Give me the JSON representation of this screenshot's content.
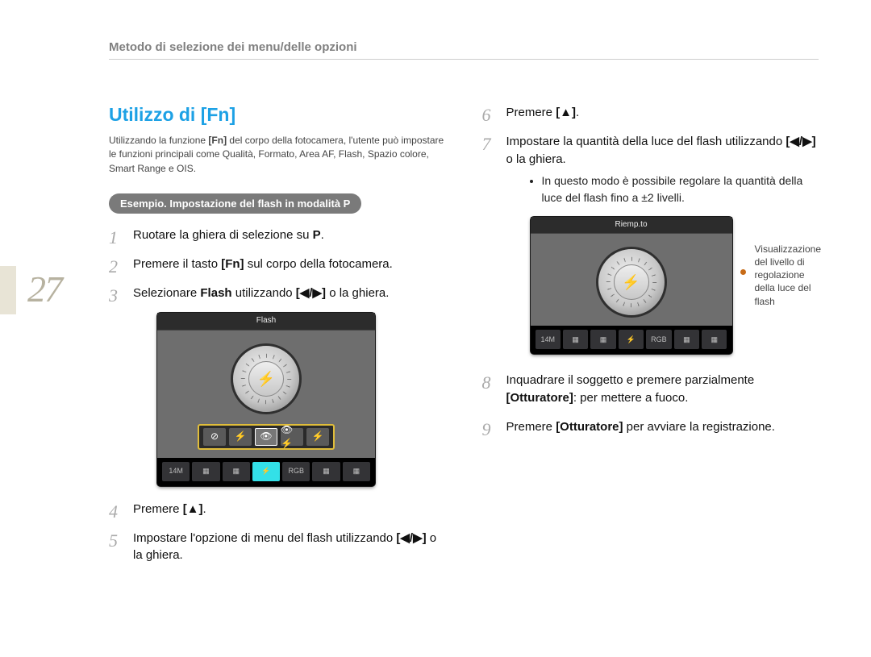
{
  "header": "Metodo di selezione dei menu/delle opzioni",
  "page_number": "27",
  "title": "Utilizzo di [Fn]",
  "intro": {
    "pre": "Utilizzando la funzione ",
    "bold": "[Fn]",
    "post": " del corpo della fotocamera, l'utente può impostare le funzioni principali come Qualità, Formato, Area AF, Flash, Spazio colore, Smart Range e OIS."
  },
  "example_pill": "Esempio. Impostazione del flash in modalità P",
  "figure1": {
    "title": "Flash",
    "dial_icon": "⚡",
    "options": [
      "⊘",
      "⚡",
      "👁",
      "👁⚡",
      "⚡"
    ],
    "thumbs": [
      "14M",
      "▦",
      "▦",
      "⚡",
      "RGB",
      "▦",
      "▦"
    ],
    "active_thumb_index": 3
  },
  "figure2": {
    "title": "Riemp.to",
    "dial_icon": "⚡",
    "annotation": "Visualizzazione del livello di regolazione della luce del flash",
    "thumbs": [
      "14M",
      "▦",
      "▦",
      "⚡",
      "RGB",
      "▦",
      "▦"
    ]
  },
  "steps_left": [
    {
      "fragments": [
        {
          "t": "Ruotare la ghiera di selezione su "
        },
        {
          "t": "P",
          "b": true
        },
        {
          "t": "."
        }
      ]
    },
    {
      "fragments": [
        {
          "t": "Premere il tasto "
        },
        {
          "t": "[Fn]",
          "b": true
        },
        {
          "t": " sul corpo della fotocamera."
        }
      ]
    },
    {
      "fragments": [
        {
          "t": "Selezionare "
        },
        {
          "t": "Flash",
          "b": true
        },
        {
          "t": " utilizzando "
        },
        {
          "t": "[◀/▶]",
          "b": true
        },
        {
          "t": " o la ghiera."
        }
      ],
      "figure": "1"
    },
    {
      "fragments": [
        {
          "t": "Premere "
        },
        {
          "t": "[▲]",
          "b": true
        },
        {
          "t": "."
        }
      ]
    },
    {
      "fragments": [
        {
          "t": "Impostare l'opzione di menu del flash utilizzando "
        },
        {
          "t": "[◀/▶]",
          "b": true
        },
        {
          "t": " o la ghiera."
        }
      ]
    }
  ],
  "steps_right": [
    {
      "fragments": [
        {
          "t": "Premere "
        },
        {
          "t": "[▲]",
          "b": true
        },
        {
          "t": "."
        }
      ]
    },
    {
      "fragments": [
        {
          "t": "Impostare la quantità della luce del flash utilizzando "
        },
        {
          "t": "[◀/▶]",
          "b": true
        },
        {
          "t": " o la ghiera."
        }
      ],
      "bullet": "In questo modo è possibile regolare la quantità della luce del flash fino a ±2 livelli.",
      "figure": "2"
    },
    {
      "fragments": [
        {
          "t": "Inquadrare il soggetto e premere parzialmente "
        },
        {
          "t": "[Otturatore]",
          "b": true
        },
        {
          "t": ": per mettere a fuoco."
        }
      ]
    },
    {
      "fragments": [
        {
          "t": "Premere "
        },
        {
          "t": "[Otturatore]",
          "b": true
        },
        {
          "t": " per avviare la registrazione."
        }
      ]
    }
  ]
}
